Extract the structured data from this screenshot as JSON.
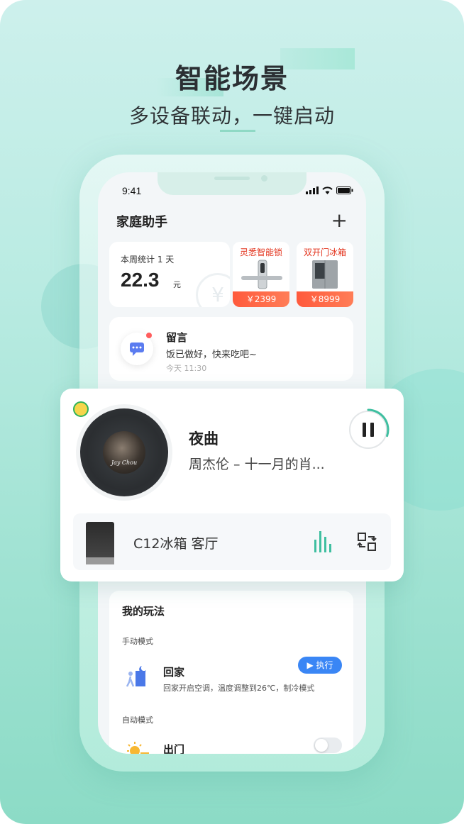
{
  "hero": {
    "title": "智能场景",
    "subtitle": "多设备联动，一键启动"
  },
  "phone": {
    "time": "9:41",
    "app_title": "家庭助手",
    "add_icon": "plus-icon",
    "stats": {
      "label": "本周统计 1 天",
      "value": "22.3",
      "unit": "元",
      "icon": "yen-coin-icon"
    },
    "products": [
      {
        "name": "灵悉智能锁",
        "price": "￥2399"
      },
      {
        "name": "双开门冰箱",
        "price": "￥8999"
      }
    ],
    "message": {
      "title": "留言",
      "text": "饭已做好，快来吃吧~",
      "time": "今天 11:30",
      "icon": "chat-bubble-icon"
    },
    "play": {
      "title": "我的玩法",
      "manual_label": "手动模式",
      "scene_home": {
        "name": "回家",
        "desc": "回家开启空调，温度调整到26℃，制冷模式",
        "exec_label": "▶ 执行"
      },
      "auto_label": "自动模式",
      "scene_out": {
        "name": "出门",
        "enabled": false
      }
    }
  },
  "player": {
    "app_icon": "qq-music-icon",
    "album_text": "Jay Chou",
    "song": "夜曲",
    "artist_line": "周杰伦 – 十一月的肖...",
    "progress": 0.3,
    "state": "playing",
    "device_name": "C12冰箱 客厅"
  },
  "colors": {
    "accent": "#3fbfa0",
    "brand_red": "#e3331c",
    "exec_blue": "#3a86f5"
  }
}
